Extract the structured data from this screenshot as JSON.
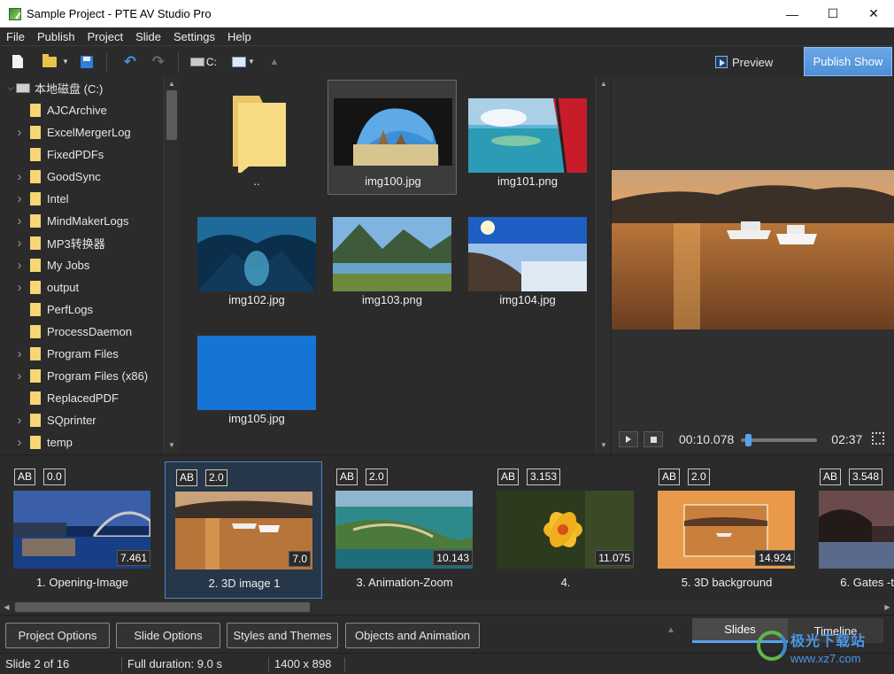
{
  "window": {
    "title": "Sample Project - PTE AV Studio Pro",
    "controls": [
      "—",
      "☐",
      "✕"
    ]
  },
  "menu": [
    "File",
    "Publish",
    "Project",
    "Slide",
    "Settings",
    "Help"
  ],
  "toolbar": {
    "drive_label": "C:",
    "preview_label": "Preview",
    "publish_label": "Publish Show"
  },
  "tree": {
    "root": "本地磁盘 (C:)",
    "items": [
      {
        "label": "AJCArchive",
        "expandable": false
      },
      {
        "label": "ExcelMergerLog",
        "expandable": true
      },
      {
        "label": "FixedPDFs",
        "expandable": false
      },
      {
        "label": "GoodSync",
        "expandable": true
      },
      {
        "label": "Intel",
        "expandable": true
      },
      {
        "label": "MindMakerLogs",
        "expandable": true
      },
      {
        "label": "MP3转换器",
        "expandable": true
      },
      {
        "label": "My Jobs",
        "expandable": true
      },
      {
        "label": "output",
        "expandable": true
      },
      {
        "label": "PerfLogs",
        "expandable": false
      },
      {
        "label": "ProcessDaemon",
        "expandable": false
      },
      {
        "label": "Program Files",
        "expandable": true
      },
      {
        "label": "Program Files (x86)",
        "expandable": true
      },
      {
        "label": "ReplacedPDF",
        "expandable": false
      },
      {
        "label": "SQprinter",
        "expandable": true
      },
      {
        "label": "temp",
        "expandable": true
      }
    ]
  },
  "files": [
    {
      "name": "..",
      "kind": "folder",
      "selected": false
    },
    {
      "name": "img100.jpg",
      "kind": "image",
      "selected": true
    },
    {
      "name": "img101.png",
      "kind": "image",
      "selected": false
    },
    {
      "name": "img102.jpg",
      "kind": "image",
      "selected": false
    },
    {
      "name": "img103.png",
      "kind": "image",
      "selected": false
    },
    {
      "name": "img104.jpg",
      "kind": "image",
      "selected": false
    },
    {
      "name": "img105.jpg",
      "kind": "image",
      "selected": false
    }
  ],
  "preview": {
    "current_time": "00:10.078",
    "total_time": "02:37",
    "progress": 0.06
  },
  "slides": [
    {
      "ab": "AB",
      "transition": "0.0",
      "duration": "7.461",
      "name": "1. Opening-Image",
      "selected": false
    },
    {
      "ab": "AB",
      "transition": "2.0",
      "duration": "7.0",
      "name": "2. 3D image 1",
      "selected": true
    },
    {
      "ab": "AB",
      "transition": "2.0",
      "duration": "10.143",
      "name": "3. Animation-Zoom",
      "selected": false
    },
    {
      "ab": "AB",
      "transition": "3.153",
      "duration": "11.075",
      "name": "4.",
      "selected": false
    },
    {
      "ab": "AB",
      "transition": "2.0",
      "duration": "14.924",
      "name": "5. 3D background",
      "selected": false
    },
    {
      "ab": "AB",
      "transition": "3.548",
      "duration": "",
      "name": "6. Gates -t",
      "selected": false
    }
  ],
  "bottom_buttons": [
    "Project Options",
    "Slide Options",
    "Styles and Themes",
    "Objects and Animation"
  ],
  "view_tabs": {
    "slides": "Slides",
    "timeline": "Timeline"
  },
  "status": {
    "slide": "Slide 2 of 16",
    "duration": "Full duration: 9.0 s",
    "resolution": "1400 x 898"
  },
  "watermark": {
    "text": "极光下载站",
    "url": "www.xz7.com"
  },
  "colors": {
    "accent": "#4f8fd6",
    "background": "#2b2b2b",
    "selection": "#26374a"
  }
}
